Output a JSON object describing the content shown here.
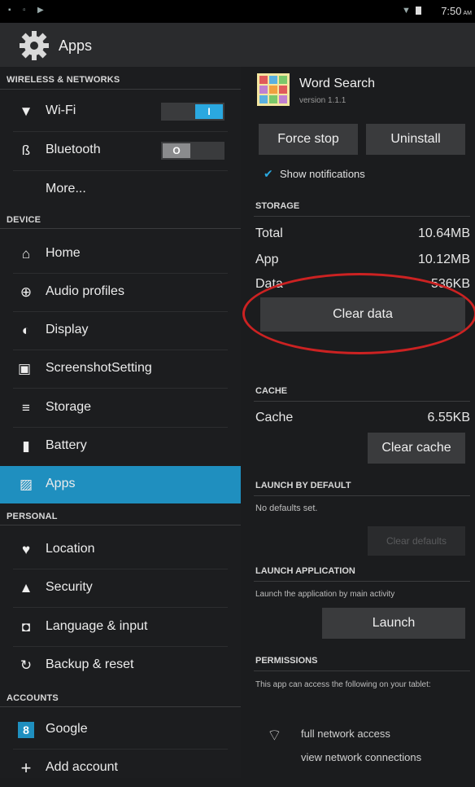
{
  "status_bar": {
    "time": "7:50",
    "ampm": "AM"
  },
  "action_bar": {
    "title": "Apps"
  },
  "sidebar": {
    "sections": {
      "wireless": "WIRELESS & NETWORKS",
      "device": "DEVICE",
      "personal": "PERSONAL",
      "accounts": "ACCOUNTS"
    },
    "items": [
      {
        "label": "Wi-Fi",
        "icon": "wifi-icon"
      },
      {
        "label": "Bluetooth",
        "icon": "bluetooth-icon"
      },
      {
        "label": "More..."
      },
      {
        "label": "Home",
        "icon": "home-icon"
      },
      {
        "label": "Audio profiles",
        "icon": "audio-profiles-icon"
      },
      {
        "label": "Display",
        "icon": "display-icon"
      },
      {
        "label": "ScreenshotSetting",
        "icon": "screenshot-icon"
      },
      {
        "label": "Storage",
        "icon": "storage-icon"
      },
      {
        "label": "Battery",
        "icon": "battery-icon"
      },
      {
        "label": "Apps",
        "icon": "apps-icon",
        "active": true
      },
      {
        "label": "Location",
        "icon": "location-icon"
      },
      {
        "label": "Security",
        "icon": "lock-icon"
      },
      {
        "label": "Language & input",
        "icon": "language-icon"
      },
      {
        "label": "Backup & reset",
        "icon": "backup-icon"
      },
      {
        "label": "Google",
        "icon": "google-icon"
      },
      {
        "label": "Add account",
        "icon": "plus-icon"
      }
    ],
    "wifi_toggle": {
      "state": "I",
      "on": true
    },
    "bluetooth_toggle": {
      "state": "O",
      "on": false
    }
  },
  "app_info": {
    "name": "Word Search",
    "version": "version 1.1.1",
    "force_stop": "Force stop",
    "uninstall": "Uninstall",
    "show_notifications": "Show notifications",
    "storage_header": "STORAGE",
    "storage_rows": [
      {
        "label": "Total",
        "value": "10.64MB"
      },
      {
        "label": "App",
        "value": "10.12MB"
      },
      {
        "label": "Data",
        "value": "536KB"
      }
    ],
    "clear_data": "Clear data",
    "cache_header": "CACHE",
    "cache_label": "Cache",
    "cache_value": "6.55KB",
    "clear_cache": "Clear cache",
    "launch_default_header": "LAUNCH BY DEFAULT",
    "no_defaults": "No defaults set.",
    "clear_defaults": "Clear defaults",
    "launch_app_header": "LAUNCH APPLICATION",
    "launch_desc": "Launch the application by main activity",
    "launch": "Launch",
    "permissions_header": "PERMISSIONS",
    "permissions_desc": "This app can access the following on your tablet:",
    "permissions": [
      "full network access",
      "view network connections"
    ]
  },
  "colors": {
    "accent": "#1f8fbf",
    "annotation": "#cc2222"
  }
}
